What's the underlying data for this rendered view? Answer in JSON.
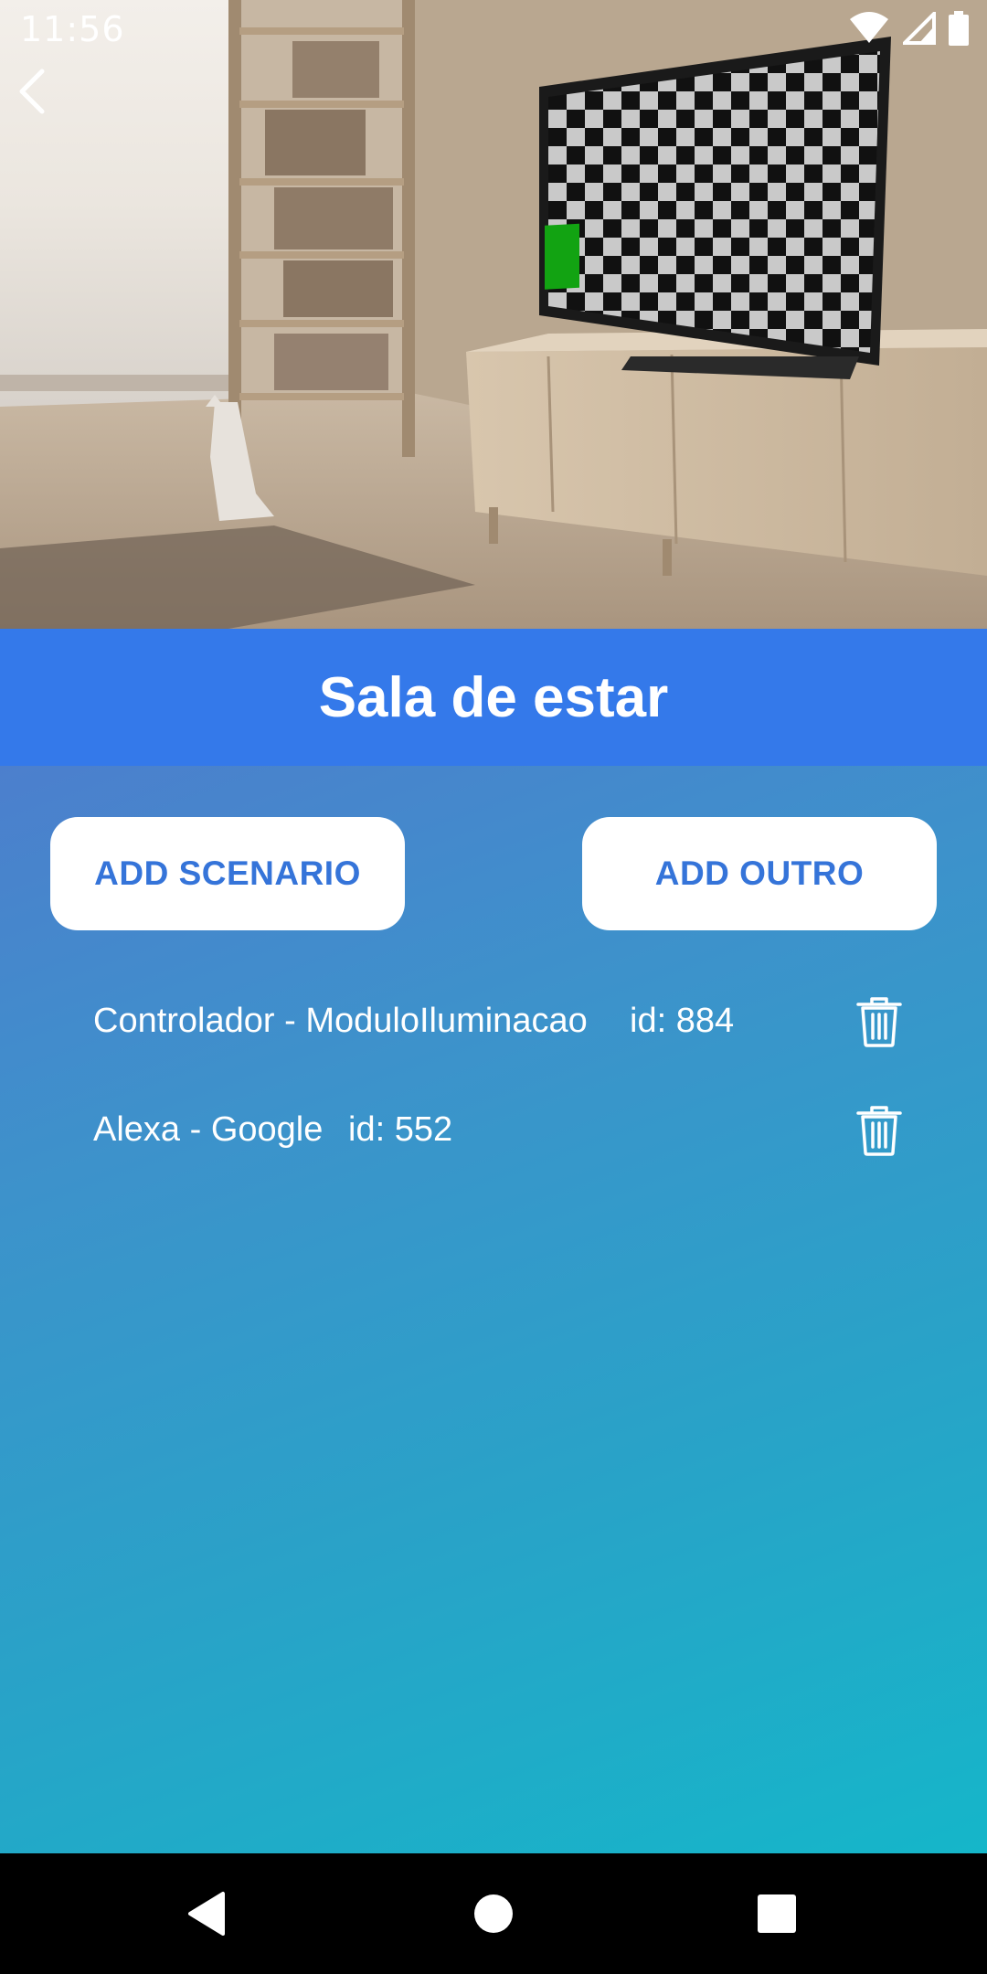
{
  "status_bar": {
    "time": "11:56",
    "icons": [
      "wifi-icon",
      "cellular-signal-icon",
      "battery-icon"
    ]
  },
  "header": {
    "back_icon": "chevron-left-icon",
    "title": "Sala de estar"
  },
  "actions": {
    "add_scenario_label": "ADD SCENARIO",
    "add_outro_label": "ADD OUTRO"
  },
  "devices": [
    {
      "name": "Controlador - ModuloIluminacao",
      "id": "id: 884"
    },
    {
      "name": "Alexa - Google",
      "id": "id: 552"
    }
  ],
  "nav": {
    "icons": [
      "back-triangle-icon",
      "home-circle-icon",
      "recents-square-icon"
    ]
  },
  "colors": {
    "title_bar": "#3479ea",
    "button_text": "#3574d9",
    "gradient_start": "#4c7fcd",
    "gradient_end": "#15b6c9"
  }
}
